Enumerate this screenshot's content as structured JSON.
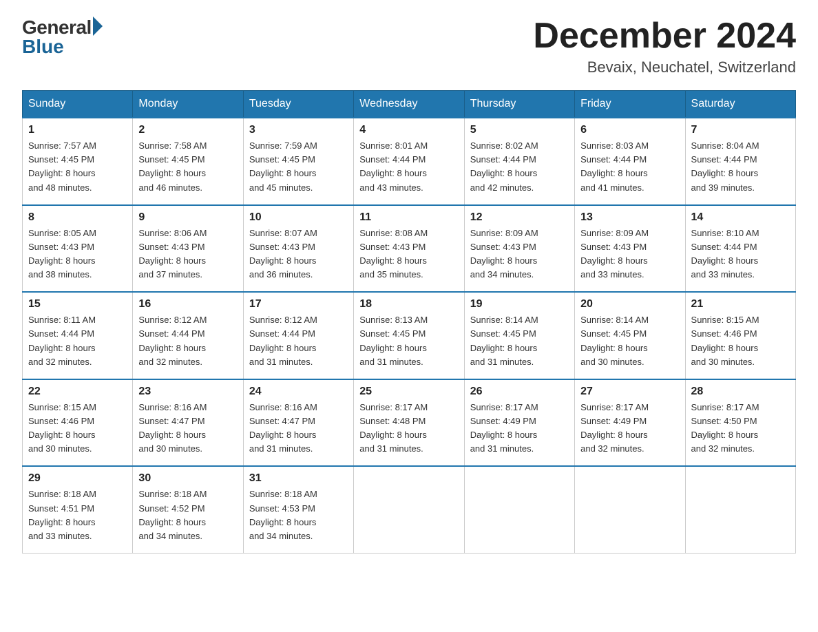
{
  "header": {
    "logo_general": "General",
    "logo_blue": "Blue",
    "month_title": "December 2024",
    "location": "Bevaix, Neuchatel, Switzerland"
  },
  "columns": [
    "Sunday",
    "Monday",
    "Tuesday",
    "Wednesday",
    "Thursday",
    "Friday",
    "Saturday"
  ],
  "weeks": [
    [
      {
        "day": "1",
        "sunrise": "7:57 AM",
        "sunset": "4:45 PM",
        "daylight": "8 hours and 48 minutes."
      },
      {
        "day": "2",
        "sunrise": "7:58 AM",
        "sunset": "4:45 PM",
        "daylight": "8 hours and 46 minutes."
      },
      {
        "day": "3",
        "sunrise": "7:59 AM",
        "sunset": "4:45 PM",
        "daylight": "8 hours and 45 minutes."
      },
      {
        "day": "4",
        "sunrise": "8:01 AM",
        "sunset": "4:44 PM",
        "daylight": "8 hours and 43 minutes."
      },
      {
        "day": "5",
        "sunrise": "8:02 AM",
        "sunset": "4:44 PM",
        "daylight": "8 hours and 42 minutes."
      },
      {
        "day": "6",
        "sunrise": "8:03 AM",
        "sunset": "4:44 PM",
        "daylight": "8 hours and 41 minutes."
      },
      {
        "day": "7",
        "sunrise": "8:04 AM",
        "sunset": "4:44 PM",
        "daylight": "8 hours and 39 minutes."
      }
    ],
    [
      {
        "day": "8",
        "sunrise": "8:05 AM",
        "sunset": "4:43 PM",
        "daylight": "8 hours and 38 minutes."
      },
      {
        "day": "9",
        "sunrise": "8:06 AM",
        "sunset": "4:43 PM",
        "daylight": "8 hours and 37 minutes."
      },
      {
        "day": "10",
        "sunrise": "8:07 AM",
        "sunset": "4:43 PM",
        "daylight": "8 hours and 36 minutes."
      },
      {
        "day": "11",
        "sunrise": "8:08 AM",
        "sunset": "4:43 PM",
        "daylight": "8 hours and 35 minutes."
      },
      {
        "day": "12",
        "sunrise": "8:09 AM",
        "sunset": "4:43 PM",
        "daylight": "8 hours and 34 minutes."
      },
      {
        "day": "13",
        "sunrise": "8:09 AM",
        "sunset": "4:43 PM",
        "daylight": "8 hours and 33 minutes."
      },
      {
        "day": "14",
        "sunrise": "8:10 AM",
        "sunset": "4:44 PM",
        "daylight": "8 hours and 33 minutes."
      }
    ],
    [
      {
        "day": "15",
        "sunrise": "8:11 AM",
        "sunset": "4:44 PM",
        "daylight": "8 hours and 32 minutes."
      },
      {
        "day": "16",
        "sunrise": "8:12 AM",
        "sunset": "4:44 PM",
        "daylight": "8 hours and 32 minutes."
      },
      {
        "day": "17",
        "sunrise": "8:12 AM",
        "sunset": "4:44 PM",
        "daylight": "8 hours and 31 minutes."
      },
      {
        "day": "18",
        "sunrise": "8:13 AM",
        "sunset": "4:45 PM",
        "daylight": "8 hours and 31 minutes."
      },
      {
        "day": "19",
        "sunrise": "8:14 AM",
        "sunset": "4:45 PM",
        "daylight": "8 hours and 31 minutes."
      },
      {
        "day": "20",
        "sunrise": "8:14 AM",
        "sunset": "4:45 PM",
        "daylight": "8 hours and 30 minutes."
      },
      {
        "day": "21",
        "sunrise": "8:15 AM",
        "sunset": "4:46 PM",
        "daylight": "8 hours and 30 minutes."
      }
    ],
    [
      {
        "day": "22",
        "sunrise": "8:15 AM",
        "sunset": "4:46 PM",
        "daylight": "8 hours and 30 minutes."
      },
      {
        "day": "23",
        "sunrise": "8:16 AM",
        "sunset": "4:47 PM",
        "daylight": "8 hours and 30 minutes."
      },
      {
        "day": "24",
        "sunrise": "8:16 AM",
        "sunset": "4:47 PM",
        "daylight": "8 hours and 31 minutes."
      },
      {
        "day": "25",
        "sunrise": "8:17 AM",
        "sunset": "4:48 PM",
        "daylight": "8 hours and 31 minutes."
      },
      {
        "day": "26",
        "sunrise": "8:17 AM",
        "sunset": "4:49 PM",
        "daylight": "8 hours and 31 minutes."
      },
      {
        "day": "27",
        "sunrise": "8:17 AM",
        "sunset": "4:49 PM",
        "daylight": "8 hours and 32 minutes."
      },
      {
        "day": "28",
        "sunrise": "8:17 AM",
        "sunset": "4:50 PM",
        "daylight": "8 hours and 32 minutes."
      }
    ],
    [
      {
        "day": "29",
        "sunrise": "8:18 AM",
        "sunset": "4:51 PM",
        "daylight": "8 hours and 33 minutes."
      },
      {
        "day": "30",
        "sunrise": "8:18 AM",
        "sunset": "4:52 PM",
        "daylight": "8 hours and 34 minutes."
      },
      {
        "day": "31",
        "sunrise": "8:18 AM",
        "sunset": "4:53 PM",
        "daylight": "8 hours and 34 minutes."
      },
      null,
      null,
      null,
      null
    ]
  ],
  "labels": {
    "sunrise_prefix": "Sunrise: ",
    "sunset_prefix": "Sunset: ",
    "daylight_prefix": "Daylight: "
  }
}
